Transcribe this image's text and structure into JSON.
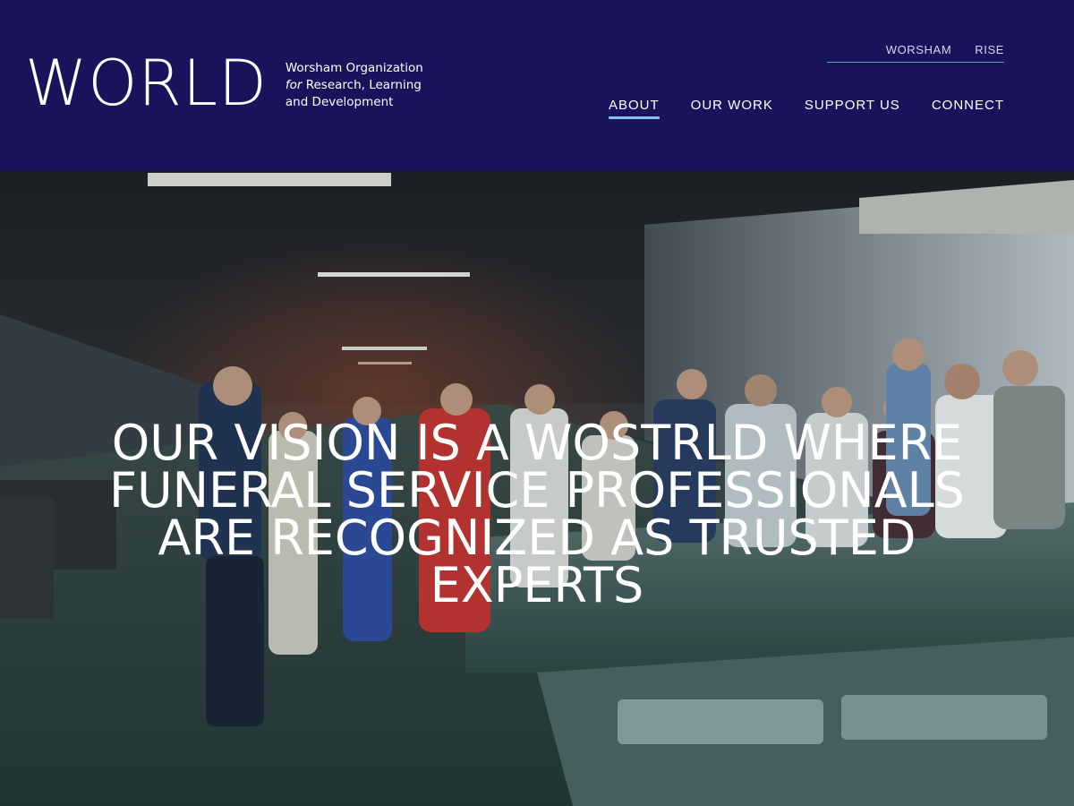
{
  "logo": {
    "wordmark": "WORLD",
    "tagline_line1": "Worsham Organization",
    "tagline_for": "for",
    "tagline_line2_rest": " Research, Learning",
    "tagline_line3": "and Development"
  },
  "utility_nav": {
    "items": [
      "WORSHAM",
      "RISE"
    ]
  },
  "main_nav": {
    "items": [
      "ABOUT",
      "OUR WORK",
      "SUPPORT US",
      "CONNECT"
    ],
    "active": "ABOUT"
  },
  "hero": {
    "heading": "OUR VISION IS A WOSTRLD WHERE FUNERAL SERVICE PROFESSIONALS ARE RECOGNIZED AS TRUSTED EXPERTS",
    "image_description_icon": "photo-warehouse-tour"
  },
  "colors": {
    "header_bg": "#18135a",
    "accent_underline": "#7fc6e6",
    "utility_rule": "#4fa79a",
    "text": "#ffffff"
  }
}
